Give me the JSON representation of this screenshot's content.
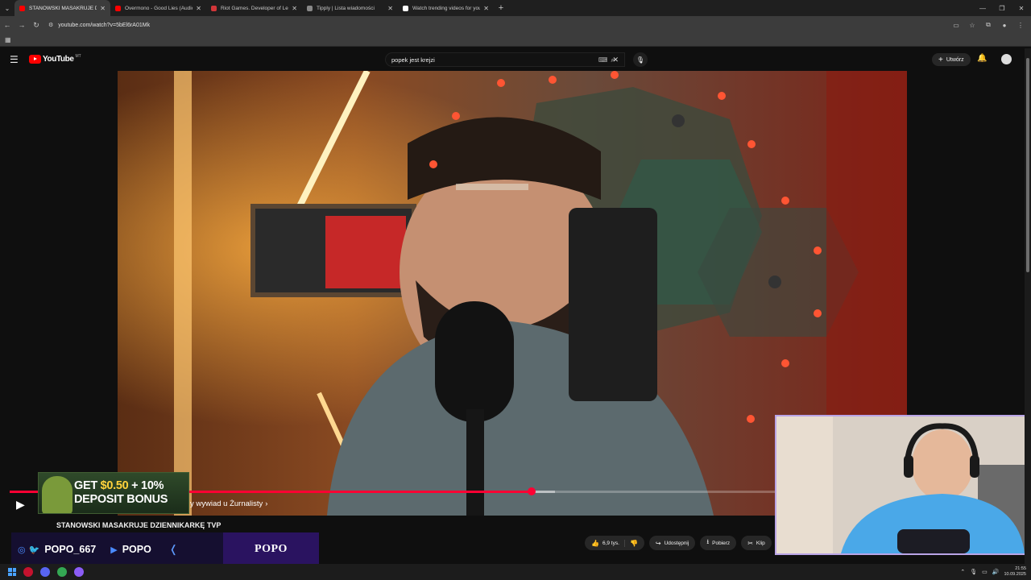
{
  "browser": {
    "tabs": [
      {
        "title": "STANOWSKI MASAKRUJE DZIENNIKARKĘ",
        "favicon_color": "#ff0000",
        "active": true
      },
      {
        "title": "Overmono - Good Lies (Audio)",
        "favicon_color": "#ff0000",
        "active": false
      },
      {
        "title": "Riot Games. Developer of League",
        "favicon_color": "#d13639",
        "active": false
      },
      {
        "title": "Tipply | Lista wiadomości",
        "favicon_color": "#888888",
        "active": false
      },
      {
        "title": "Watch trending videos for you",
        "favicon_color": "#ffffff",
        "active": false
      }
    ],
    "url": "youtube.com/watch?v=5bEl6rA01Mk"
  },
  "youtube": {
    "logo_text": "YouTube",
    "country_code": "MT",
    "search_query": "popek jest krejzi",
    "create_label": "Utwórz"
  },
  "video": {
    "chapter_label": "y wywiad u Żurnalisty",
    "progress_played": 0.675,
    "title": "STANOWSKI MASAKRUJE DZIENNIKARKĘ TVP"
  },
  "ad": {
    "line1_prefix": "GET ",
    "line1_money": "$0.50",
    "line1_suffix": " + 10%",
    "line2": "DEPOSIT BONUS"
  },
  "actions": {
    "likes": "6,9 tys.",
    "share": "Udostępnij",
    "download": "Pobierz",
    "clip": "Klip"
  },
  "social": {
    "handle_ig_tw": "POPO_667",
    "handle_yt": "POPO",
    "brand": "POPO"
  },
  "taskbar": {
    "time": "21:55",
    "date": "10.09.2025"
  },
  "colors": {
    "yt_red": "#ff0000",
    "progress_red": "#ff0033",
    "webcam_border": "#b9a4e6"
  }
}
